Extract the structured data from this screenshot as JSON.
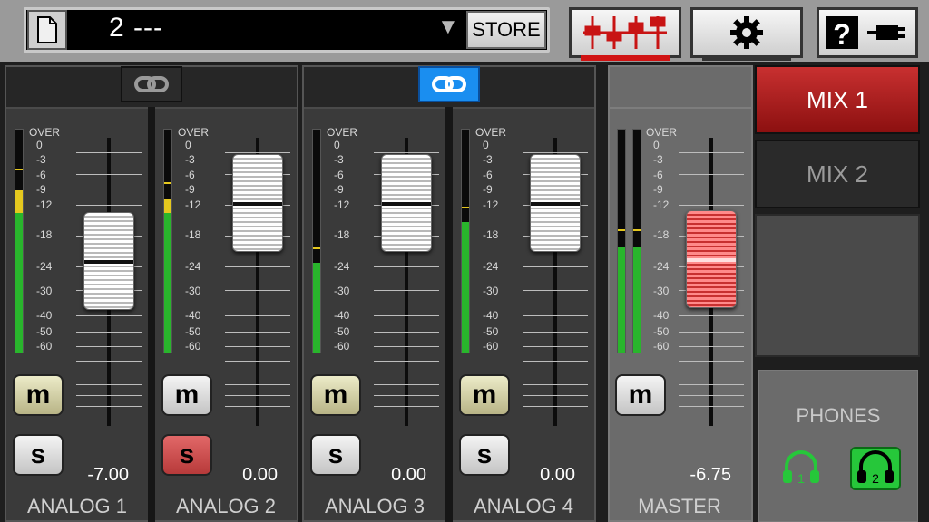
{
  "preset": {
    "number_name": "2 ---",
    "store_label": "STORE",
    "arrow": "▼"
  },
  "tabs": [
    {
      "name": "mixer-tab",
      "icon": "mixer-faders-icon",
      "active": true
    },
    {
      "name": "settings-tab",
      "icon": "gear-icon",
      "active": false
    },
    {
      "name": "help-tab",
      "icon": "help-connection-icon",
      "active": false
    }
  ],
  "scale": [
    "OVER",
    "0",
    "-3",
    "-6",
    "-9",
    "-12",
    "-18",
    "-24",
    "-30",
    "-40",
    "-50",
    "-60"
  ],
  "channels": [
    {
      "name": "ANALOG 1",
      "gain": "-7.00",
      "mute_label": "m",
      "solo_label": "s",
      "mute": true,
      "solo": false,
      "meter_level": 0.72,
      "meter_peak": 0.81
    },
    {
      "name": "ANALOG 2",
      "gain": "0.00",
      "mute_label": "m",
      "solo_label": "s",
      "mute": false,
      "solo": true,
      "meter_level": 0.68,
      "meter_peak": 0.75
    },
    {
      "name": "ANALOG 3",
      "gain": "0.00",
      "mute_label": "m",
      "solo_label": "s",
      "mute": true,
      "solo": false,
      "meter_level": 0.4,
      "meter_peak": 0.46
    },
    {
      "name": "ANALOG 4",
      "gain": "0.00",
      "mute_label": "m",
      "solo_label": "s",
      "mute": true,
      "solo": false,
      "meter_level": 0.58,
      "meter_peak": 0.64
    }
  ],
  "master": {
    "name": "MASTER",
    "gain": "-6.75",
    "mute_label": "m",
    "mute": false,
    "meter_level": 0.47,
    "meter_peak": 0.54
  },
  "links": [
    {
      "state": "off"
    },
    {
      "state": "on"
    }
  ],
  "mix": {
    "mix1": "MIX 1",
    "mix2": "MIX 2"
  },
  "phones": {
    "label": "PHONES",
    "hp1": "1",
    "hp2": "2",
    "active": "2"
  },
  "colors": {
    "accent_red": "#c83030",
    "link_blue": "#1a8ef0",
    "phones_green": "#26c73a"
  }
}
